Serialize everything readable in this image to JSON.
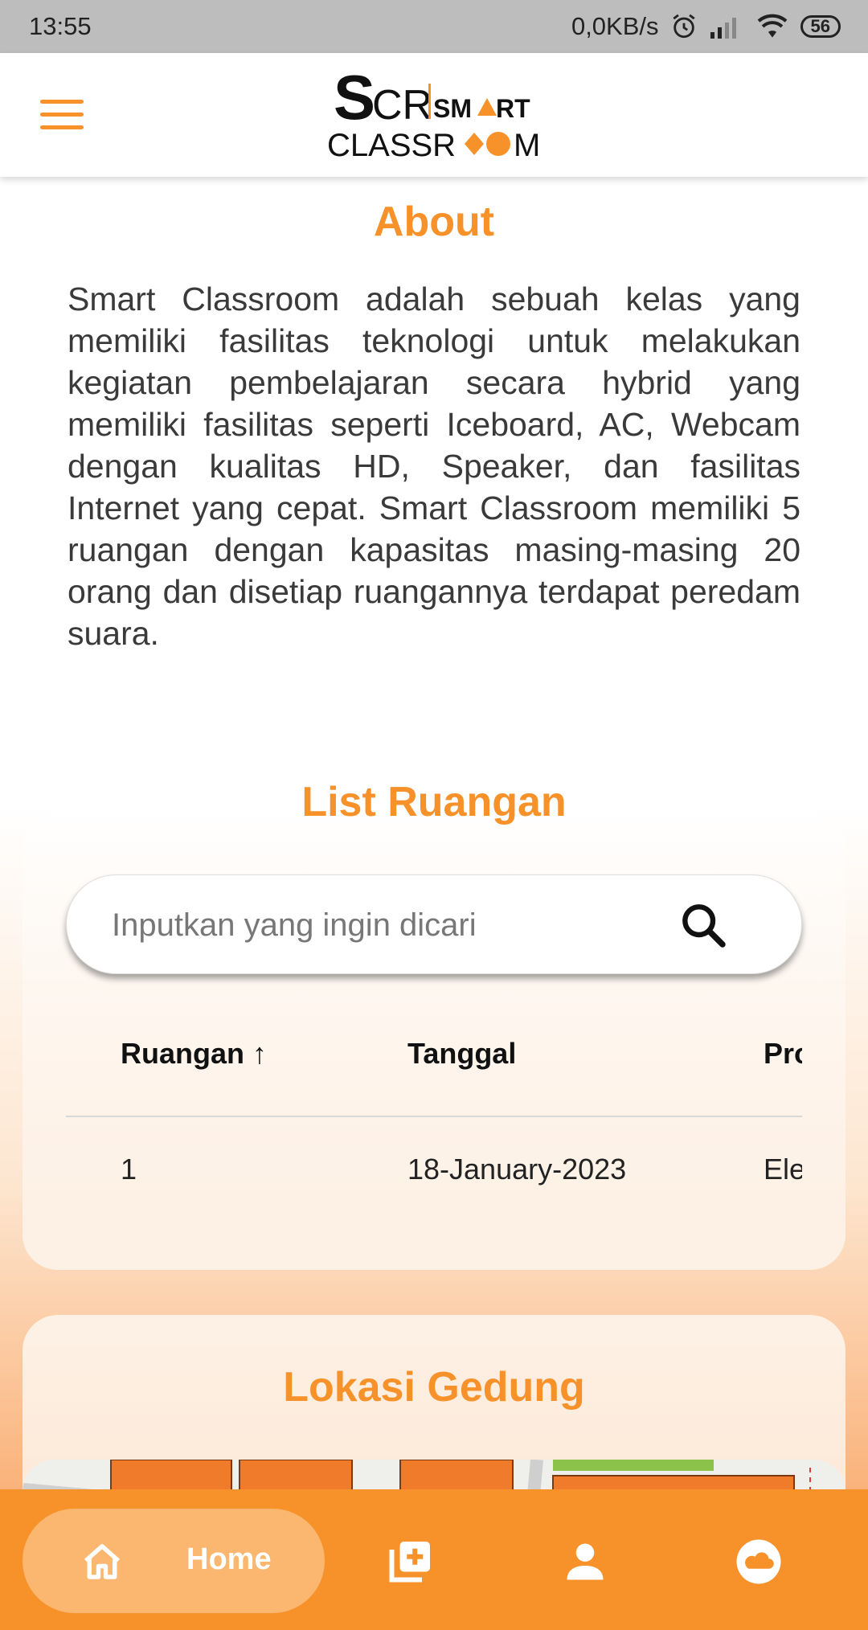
{
  "status_bar": {
    "time": "13:55",
    "speed": "0,0KB/s",
    "battery": "56"
  },
  "header": {
    "logo_text_big": "SCR",
    "logo_text_smart": "SMART",
    "logo_text_classroom": "CLASSR",
    "logo_text_m": "M"
  },
  "about": {
    "title": "About",
    "text": "Smart Classroom adalah sebuah kelas yang memiliki fasilitas teknologi untuk melakukan kegiatan pembelajaran secara hybrid yang memiliki fasilitas seperti Iceboard, AC, Webcam dengan kualitas HD, Speaker, dan fasilitas Internet yang cepat. Smart Classroom memiliki 5 ruangan dengan kapasitas masing-masing 20 orang dan disetiap ruangannya terdapat peredam suara."
  },
  "list": {
    "title": "List Ruangan",
    "search_placeholder": "Inputkan yang ingin dicari",
    "columns": [
      "Ruangan",
      "Tanggal",
      "Pro"
    ],
    "sort_indicator": "↑",
    "rows": [
      [
        "1",
        "18-January-2023",
        "Ele"
      ]
    ]
  },
  "location": {
    "title": "Lokasi Gedung"
  },
  "bottom_nav": {
    "home_label": "Home"
  },
  "colors": {
    "accent": "#f7922b",
    "pill": "#fbb66f"
  },
  "icons": [
    "menu-icon",
    "search-icon",
    "home-icon",
    "add-box-icon",
    "person-icon",
    "cloud-icon",
    "alarm-icon",
    "signal-icon",
    "wifi-icon",
    "battery-icon"
  ]
}
